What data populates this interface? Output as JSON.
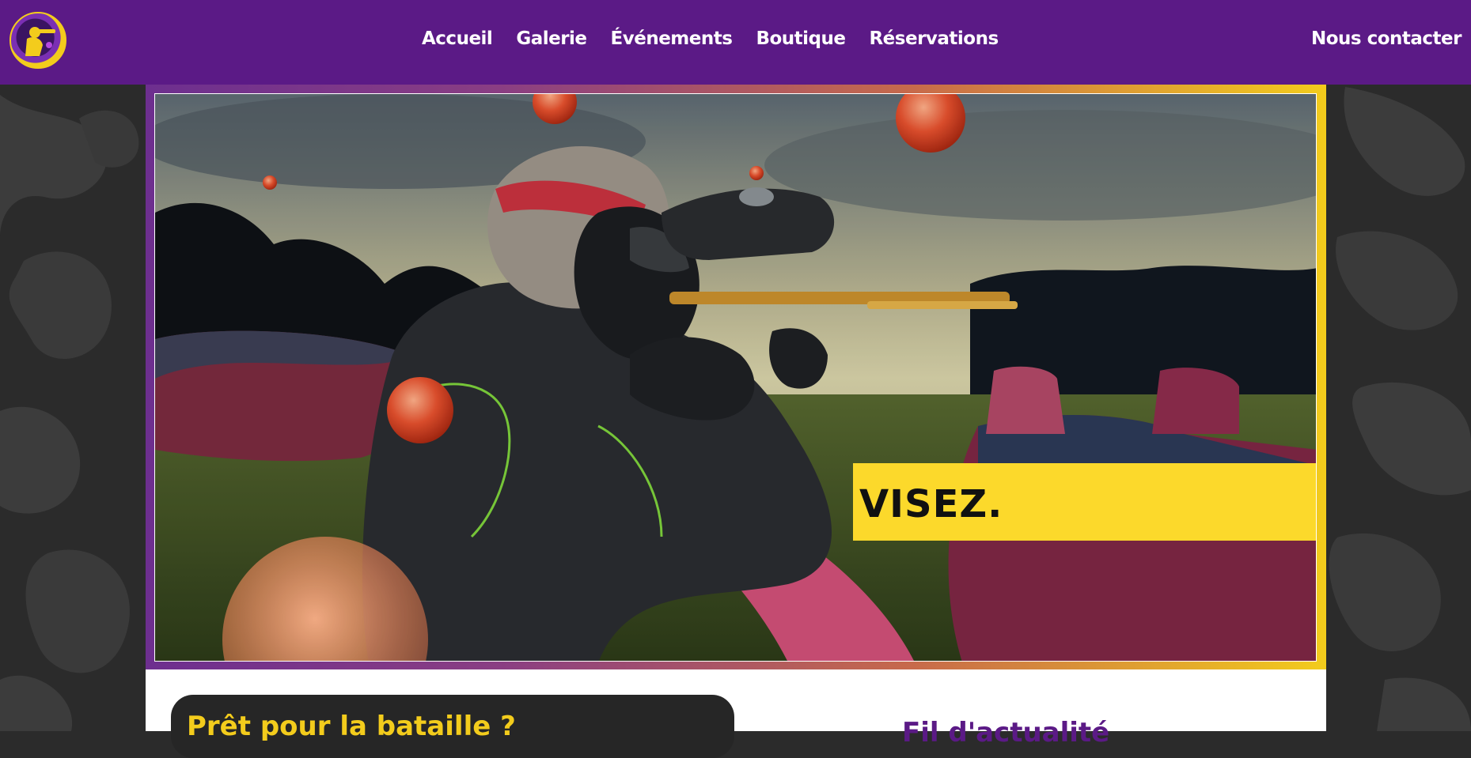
{
  "brand": {
    "logo_icon": "paintball-player-logo-icon"
  },
  "nav": {
    "items": [
      "Accueil",
      "Galerie",
      "Événements",
      "Boutique",
      "Réservations"
    ],
    "contact": "Nous contacter"
  },
  "hero": {
    "image": "paintball-player-aiming-photo",
    "tagline": "VISEZ."
  },
  "cta": {
    "title": "Prêt pour la bataille ?"
  },
  "news": {
    "title": "Fil d'actualité"
  },
  "colors": {
    "header": "#5b1a86",
    "accent_yellow": "#fcd92b",
    "background": "#2b2b2b",
    "card_dark": "#262626"
  }
}
